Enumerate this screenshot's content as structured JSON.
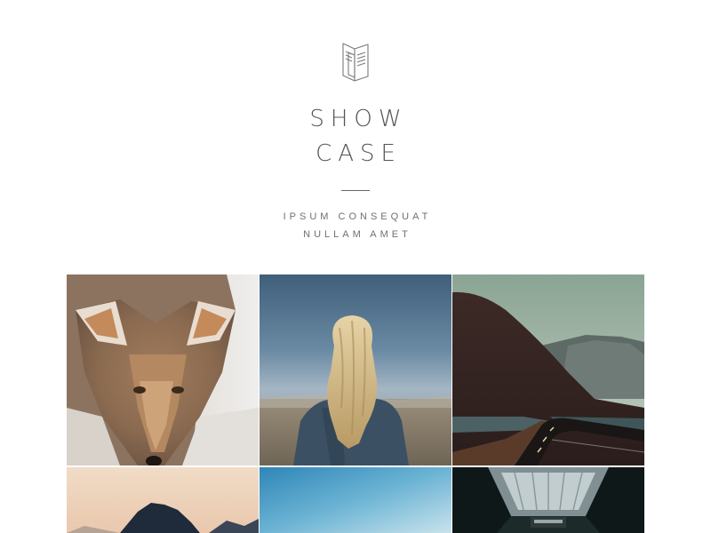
{
  "header": {
    "logo_icon": "open-book-icon",
    "title_line1": "SHOW",
    "title_line2": "CASE",
    "subtitle_line1": "IPSUM CONSEQUAT",
    "subtitle_line2": "NULLAM AMET"
  },
  "gallery": {
    "items": [
      {
        "subject": "coyote"
      },
      {
        "subject": "woman-with-blonde-hair-facing-away"
      },
      {
        "subject": "mountain-road"
      },
      {
        "subject": "mountain-peak-at-dusk"
      },
      {
        "subject": "blue-sky"
      },
      {
        "subject": "dark-corridor-skylight"
      }
    ]
  },
  "colors": {
    "text": "#555555",
    "background": "#ffffff"
  }
}
